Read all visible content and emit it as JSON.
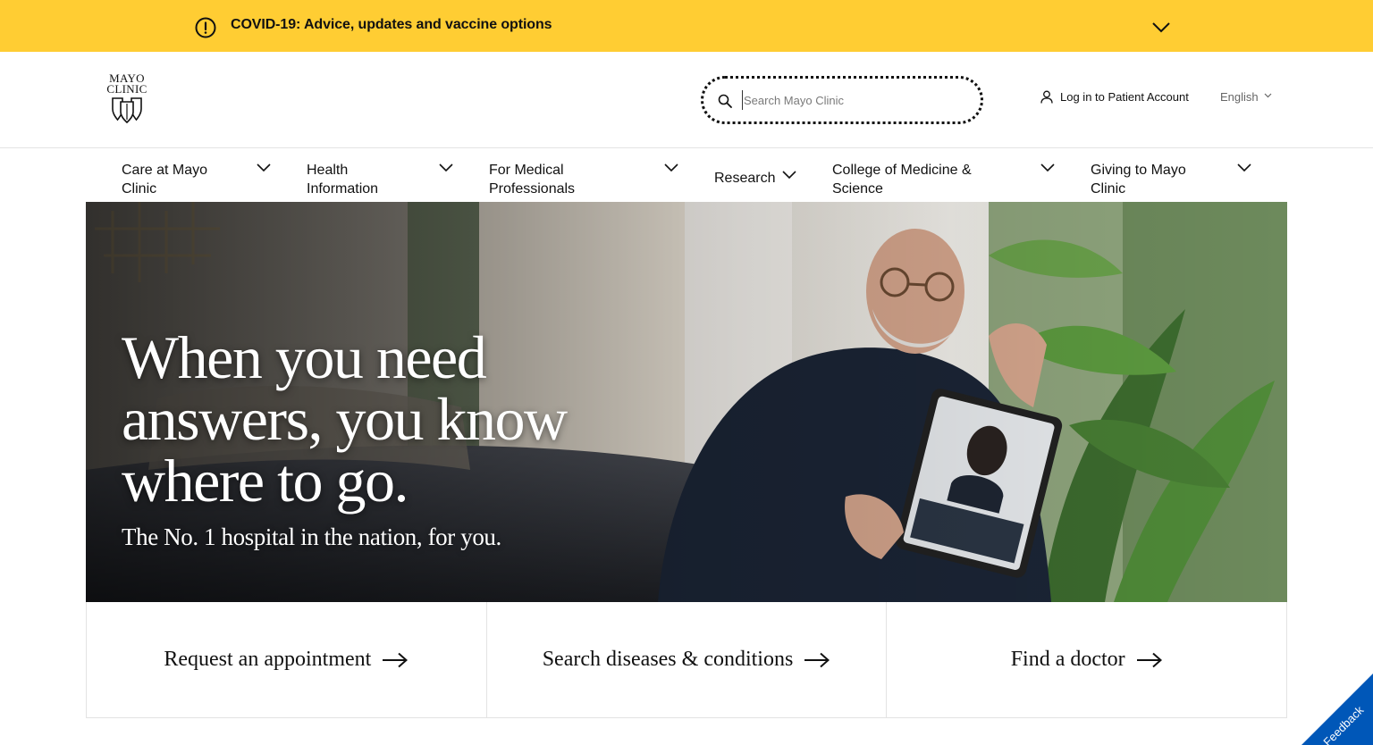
{
  "covid_banner": {
    "text": "COVID-19: Advice, updates and vaccine options",
    "background": "#ffcd33"
  },
  "header": {
    "logo": {
      "line1": "MAYO",
      "line2": "CLINIC"
    },
    "search": {
      "placeholder": "Search Mayo Clinic",
      "value": ""
    },
    "login_label": "Log in to Patient Account",
    "language": "English"
  },
  "nav": {
    "items": [
      {
        "line1": "Care at Mayo",
        "line2": "Clinic"
      },
      {
        "line1": "Health",
        "line2": "Information"
      },
      {
        "line1": "For Medical",
        "line2": "Professionals"
      },
      {
        "line1": "Research",
        "line2": ""
      },
      {
        "line1": "College of Medicine &",
        "line2": "Science"
      },
      {
        "line1": "Giving to Mayo",
        "line2": "Clinic"
      }
    ]
  },
  "hero": {
    "title_lines": [
      "When you need",
      "answers, you know",
      "where to go."
    ],
    "subtitle": "The No. 1 hospital in the nation, for you."
  },
  "actions": [
    {
      "label": "Request an appointment"
    },
    {
      "label": "Search diseases & conditions"
    },
    {
      "label": "Find a doctor"
    }
  ],
  "feedback": {
    "label": "Feedback",
    "color": "#0057b8"
  },
  "icons": [
    "alert-circle-icon",
    "chevron-down-icon",
    "search-icon",
    "user-icon",
    "arrow-right-icon",
    "mayo-shield-icon"
  ]
}
